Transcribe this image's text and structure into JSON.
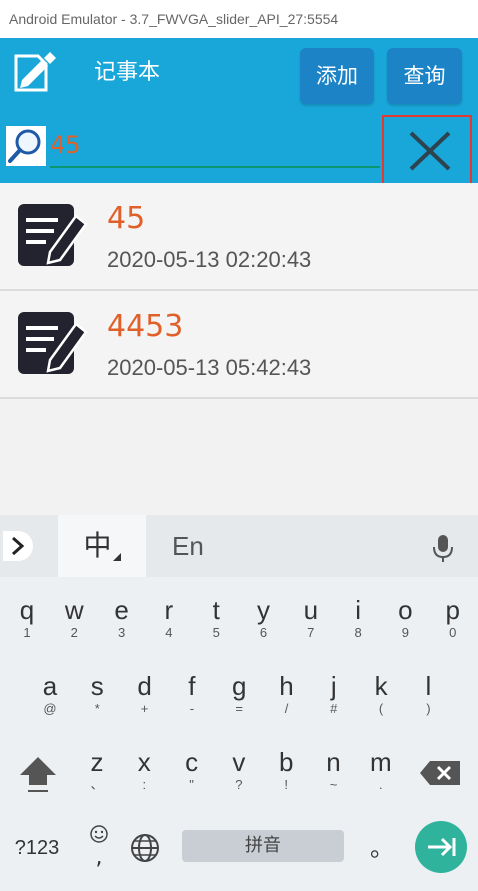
{
  "window": {
    "title": "Android Emulator - 3.7_FWVGA_slider_API_27:5554"
  },
  "appbar": {
    "title": "记事本",
    "add_label": "添加",
    "query_label": "查询"
  },
  "search": {
    "value": "45"
  },
  "notes": [
    {
      "title": "45",
      "time": "2020-05-13 02:20:43"
    },
    {
      "title": "4453",
      "time": "2020-05-13 05:42:43"
    }
  ],
  "keyboard": {
    "tab_zh": "中",
    "tab_en": "En",
    "row1": [
      {
        "m": "q",
        "s": "1"
      },
      {
        "m": "w",
        "s": "2"
      },
      {
        "m": "e",
        "s": "3"
      },
      {
        "m": "r",
        "s": "4"
      },
      {
        "m": "t",
        "s": "5"
      },
      {
        "m": "y",
        "s": "6"
      },
      {
        "m": "u",
        "s": "7"
      },
      {
        "m": "i",
        "s": "8"
      },
      {
        "m": "o",
        "s": "9"
      },
      {
        "m": "p",
        "s": "0"
      }
    ],
    "row2": [
      {
        "m": "a",
        "s": "@"
      },
      {
        "m": "s",
        "s": "*"
      },
      {
        "m": "d",
        "s": "+"
      },
      {
        "m": "f",
        "s": "-"
      },
      {
        "m": "g",
        "s": "="
      },
      {
        "m": "h",
        "s": "/"
      },
      {
        "m": "j",
        "s": "#"
      },
      {
        "m": "k",
        "s": "("
      },
      {
        "m": "l",
        "s": ")"
      }
    ],
    "row3": [
      {
        "m": "z",
        "s": "、"
      },
      {
        "m": "x",
        "s": ":"
      },
      {
        "m": "c",
        "s": "\""
      },
      {
        "m": "v",
        "s": "?"
      },
      {
        "m": "b",
        "s": "!"
      },
      {
        "m": "n",
        "s": "~"
      },
      {
        "m": "m",
        "s": "."
      }
    ],
    "num_label": "?123",
    "emoji_sub": ",",
    "space_label": "拼音",
    "period": "。",
    "accent_color": "#2fb39c"
  }
}
